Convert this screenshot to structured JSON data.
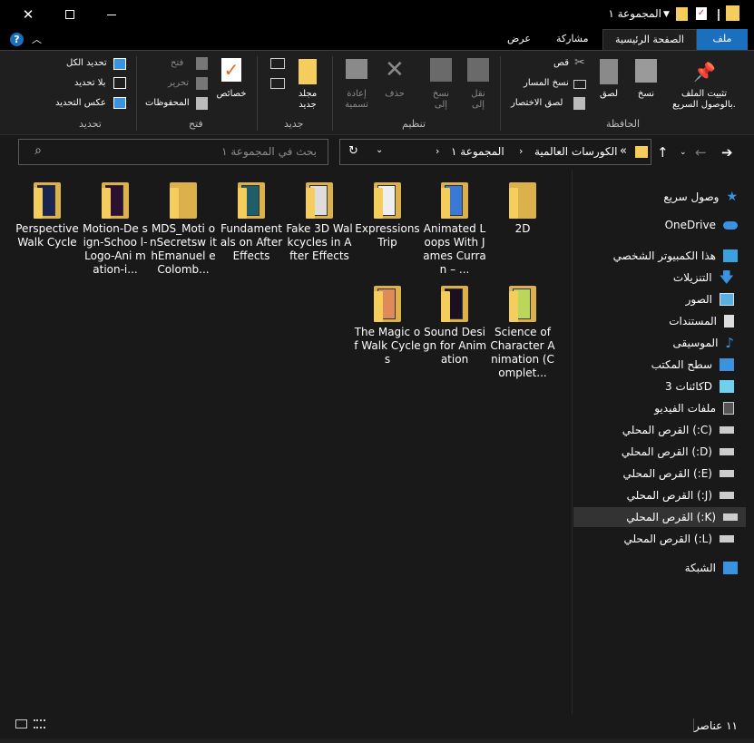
{
  "window": {
    "title": "المجموعة ١"
  },
  "tabs": {
    "file": "ملف",
    "home": "الصفحة الرئيسية",
    "share": "مشاركة",
    "view": "عرض"
  },
  "ribbon": {
    "clipboard": {
      "group": "الحافظة",
      "pin": "تثبيت الملف\nبالوصول السريع.",
      "copy": "نسخ",
      "paste": "لصق",
      "cut": "قص",
      "copy_path": "نسخ المسار",
      "paste_shortcut": "لصق الاختصار"
    },
    "organize": {
      "group": "تنظيم",
      "move_to": "نقل\nإلى",
      "copy_to": "نسخ\nإلى",
      "delete": "حذف",
      "rename": "إعادة\nتسمية"
    },
    "new": {
      "group": "جديد",
      "new_folder": "مجلد\nجديد"
    },
    "open": {
      "group": "فتح",
      "properties": "خصائص",
      "open": "فتح",
      "edit": "تحرير",
      "history": "المحفوظات"
    },
    "select": {
      "group": "تحديد",
      "select_all": "تحديد الكل",
      "select_none": "بلا تحديد",
      "invert": "عكس التحديد"
    }
  },
  "address": {
    "crumbs": [
      "الكورسات العالمية",
      "المجموعة ١"
    ],
    "prefix": "«"
  },
  "search": {
    "placeholder": "بحث في المجموعة ١"
  },
  "items": [
    {
      "name": "2D",
      "thumb": "plain"
    },
    {
      "name": "Animated Loops With James Curran – ...",
      "thumb": "blue"
    },
    {
      "name": "Expressions Trip",
      "thumb": "white"
    },
    {
      "name": "Fake 3D Walkcycles in After Effects",
      "thumb": "sketch"
    },
    {
      "name": "Fundament als on After Effects",
      "thumb": "teal"
    },
    {
      "name": "MDS_Moti onSecretsw ithEmanuel eColomb...",
      "thumb": "plain"
    },
    {
      "name": "Motion-De sign-Schoo l-Logo-Ani mation-i...",
      "thumb": "dark"
    },
    {
      "name": "Perspective Walk Cycle",
      "thumb": "navy"
    },
    {
      "name": "Science of Character Animation (Complet...",
      "thumb": "green"
    },
    {
      "name": "Sound Design for Animation",
      "thumb": "black"
    },
    {
      "name": "The Magic of Walk Cycles",
      "thumb": "orange"
    }
  ],
  "sidebar": {
    "quick_access": "وصول سريع",
    "onedrive": "OneDrive",
    "this_pc": "هذا الكمبيوتر الشخصي",
    "downloads": "التنزيلات",
    "pictures": "الصور",
    "documents": "المستندات",
    "music": "الموسيقى",
    "desktop": "سطح المكتب",
    "objects3d": "كائنات 3D",
    "videos": "ملفات الفيديو",
    "drives": [
      "القرص المحلي (:C)",
      "القرص المحلي (:D)",
      "القرص المحلي (:E)",
      "القرص المحلي (:J)",
      "القرص المحلي (:K)",
      "القرص المحلي (:L)"
    ],
    "network": "الشبكة"
  },
  "status": {
    "count": "١١ عناصر"
  },
  "colors": {
    "accent": "#1a6fbf",
    "folder": "#f5cd5d",
    "background": "#191919"
  }
}
